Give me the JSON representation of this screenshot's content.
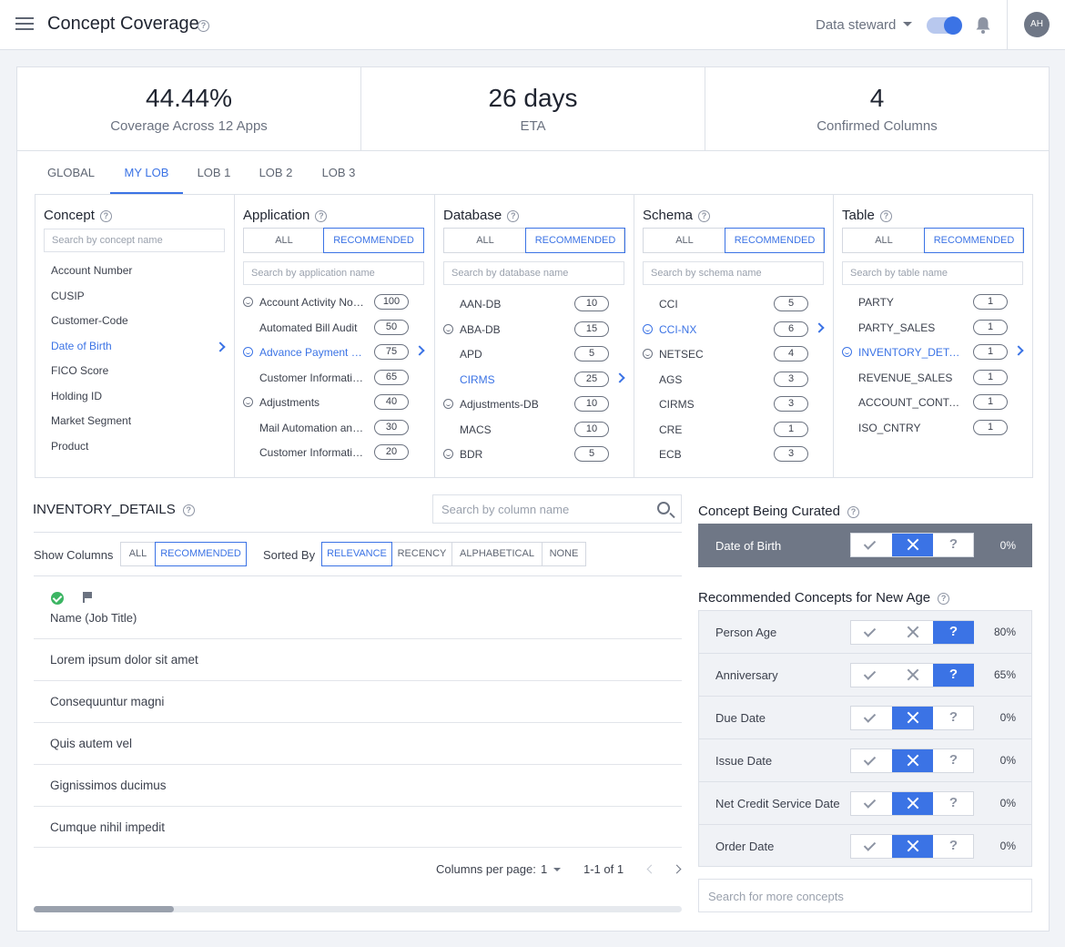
{
  "header": {
    "title": "Concept Coverage",
    "role": "Data steward",
    "avatar_initials": "AH"
  },
  "stats": [
    {
      "value": "44.44%",
      "label": "Coverage Across 12 Apps"
    },
    {
      "value": "26 days",
      "label": "ETA"
    },
    {
      "value": "4",
      "label": "Confirmed Columns"
    }
  ],
  "tabs": [
    "GLOBAL",
    "MY LOB",
    "LOB 1",
    "LOB 2",
    "LOB 3"
  ],
  "active_tab": "MY LOB",
  "segment": {
    "all": "ALL",
    "recommended": "RECOMMENDED"
  },
  "concept": {
    "title": "Concept",
    "search_placeholder": "Search by concept name",
    "items": [
      "Account Number",
      "CUSIP",
      "Customer-Code",
      "Date of Birth",
      "FICO Score",
      "Holding ID",
      "Market Segment",
      "Product"
    ],
    "selected": "Date of Birth"
  },
  "application": {
    "title": "Application",
    "search_placeholder": "Search by application name",
    "items": [
      {
        "label": "Account Activity Notifi...",
        "count": "100",
        "smile": true
      },
      {
        "label": "Automated Bill Audit",
        "count": "50",
        "smile": false
      },
      {
        "label": "Advance Payment and...",
        "count": "75",
        "smile": true,
        "selected": true
      },
      {
        "label": "Customer Information...",
        "count": "65",
        "smile": false
      },
      {
        "label": "Adjustments",
        "count": "40",
        "smile": true
      },
      {
        "label": "Mail Automation and...",
        "count": "30",
        "smile": false
      },
      {
        "label": "Customer Information...",
        "count": "20",
        "smile": false
      }
    ]
  },
  "database": {
    "title": "Database",
    "search_placeholder": "Search by database name",
    "items": [
      {
        "label": "AAN-DB",
        "count": "10",
        "smile": false
      },
      {
        "label": "ABA-DB",
        "count": "15",
        "smile": true
      },
      {
        "label": "APD",
        "count": "5",
        "smile": false
      },
      {
        "label": "CIRMS",
        "count": "25",
        "smile": false,
        "selected": true
      },
      {
        "label": "Adjustments-DB",
        "count": "10",
        "smile": true
      },
      {
        "label": "MACS",
        "count": "10",
        "smile": false
      },
      {
        "label": "BDR",
        "count": "5",
        "smile": true
      }
    ]
  },
  "schema": {
    "title": "Schema",
    "search_placeholder": "Search by schema name",
    "items": [
      {
        "label": "CCI",
        "count": "5",
        "smile": false
      },
      {
        "label": "CCI-NX",
        "count": "6",
        "smile": true,
        "selected": true
      },
      {
        "label": "NETSEC",
        "count": "4",
        "smile": true
      },
      {
        "label": "AGS",
        "count": "3",
        "smile": false
      },
      {
        "label": "CIRMS",
        "count": "3",
        "smile": false
      },
      {
        "label": "CRE",
        "count": "1",
        "smile": false
      },
      {
        "label": "ECB",
        "count": "3",
        "smile": false
      }
    ]
  },
  "table": {
    "title": "Table",
    "search_placeholder": "Search by table name",
    "items": [
      {
        "label": "PARTY",
        "count": "1",
        "smile": false
      },
      {
        "label": "PARTY_SALES",
        "count": "1",
        "smile": false
      },
      {
        "label": "INVENTORY_DETAILS",
        "count": "1",
        "smile": true,
        "selected": true
      },
      {
        "label": "REVENUE_SALES",
        "count": "1",
        "smile": false
      },
      {
        "label": "ACCOUNT_CONTACT",
        "count": "1",
        "smile": false
      },
      {
        "label": "ISO_CNTRY",
        "count": "1",
        "smile": false
      }
    ]
  },
  "columns_panel": {
    "title": "INVENTORY_DETAILS",
    "search_placeholder": "Search by column name",
    "show_columns_label": "Show Columns",
    "show_options": [
      "ALL",
      "RECOMMENDED"
    ],
    "show_selected": "RECOMMENDED",
    "sorted_by_label": "Sorted By",
    "sort_options": [
      "RELEVANCE",
      "RECENCY",
      "ALPHABETICAL",
      "NONE"
    ],
    "sort_selected": "RELEVANCE",
    "column_header": "Name (Job Title)",
    "rows": [
      "Lorem ipsum dolor sit amet",
      "Consequuntur magni",
      "Quis autem vel",
      "Gignissimos ducimus",
      "Cumque nihil impedit"
    ],
    "pagination": {
      "per_page_label": "Columns per page:",
      "per_page": "1",
      "range": "1-1 of 1"
    }
  },
  "curation": {
    "title": "Concept Being Curated",
    "concept": "Date of Birth",
    "state": "reject",
    "percent": "0%",
    "recommended_title": "Recommended Concepts for New Age",
    "recommended": [
      {
        "label": "Person Age",
        "state": "unknown",
        "percent": "80%"
      },
      {
        "label": "Anniversary",
        "state": "unknown",
        "percent": "65%"
      },
      {
        "label": "Due Date",
        "state": "reject",
        "percent": "0%"
      },
      {
        "label": "Issue Date",
        "state": "reject",
        "percent": "0%"
      },
      {
        "label": "Net Credit Service Date",
        "state": "reject",
        "percent": "0%"
      },
      {
        "label": "Order Date",
        "state": "reject",
        "percent": "0%"
      }
    ],
    "more_placeholder": "Search for more concepts",
    "question_glyph": "?"
  },
  "colors": {
    "accent": "#3b73e5",
    "success": "#3cb563",
    "curated_bg": "#6f7786"
  }
}
